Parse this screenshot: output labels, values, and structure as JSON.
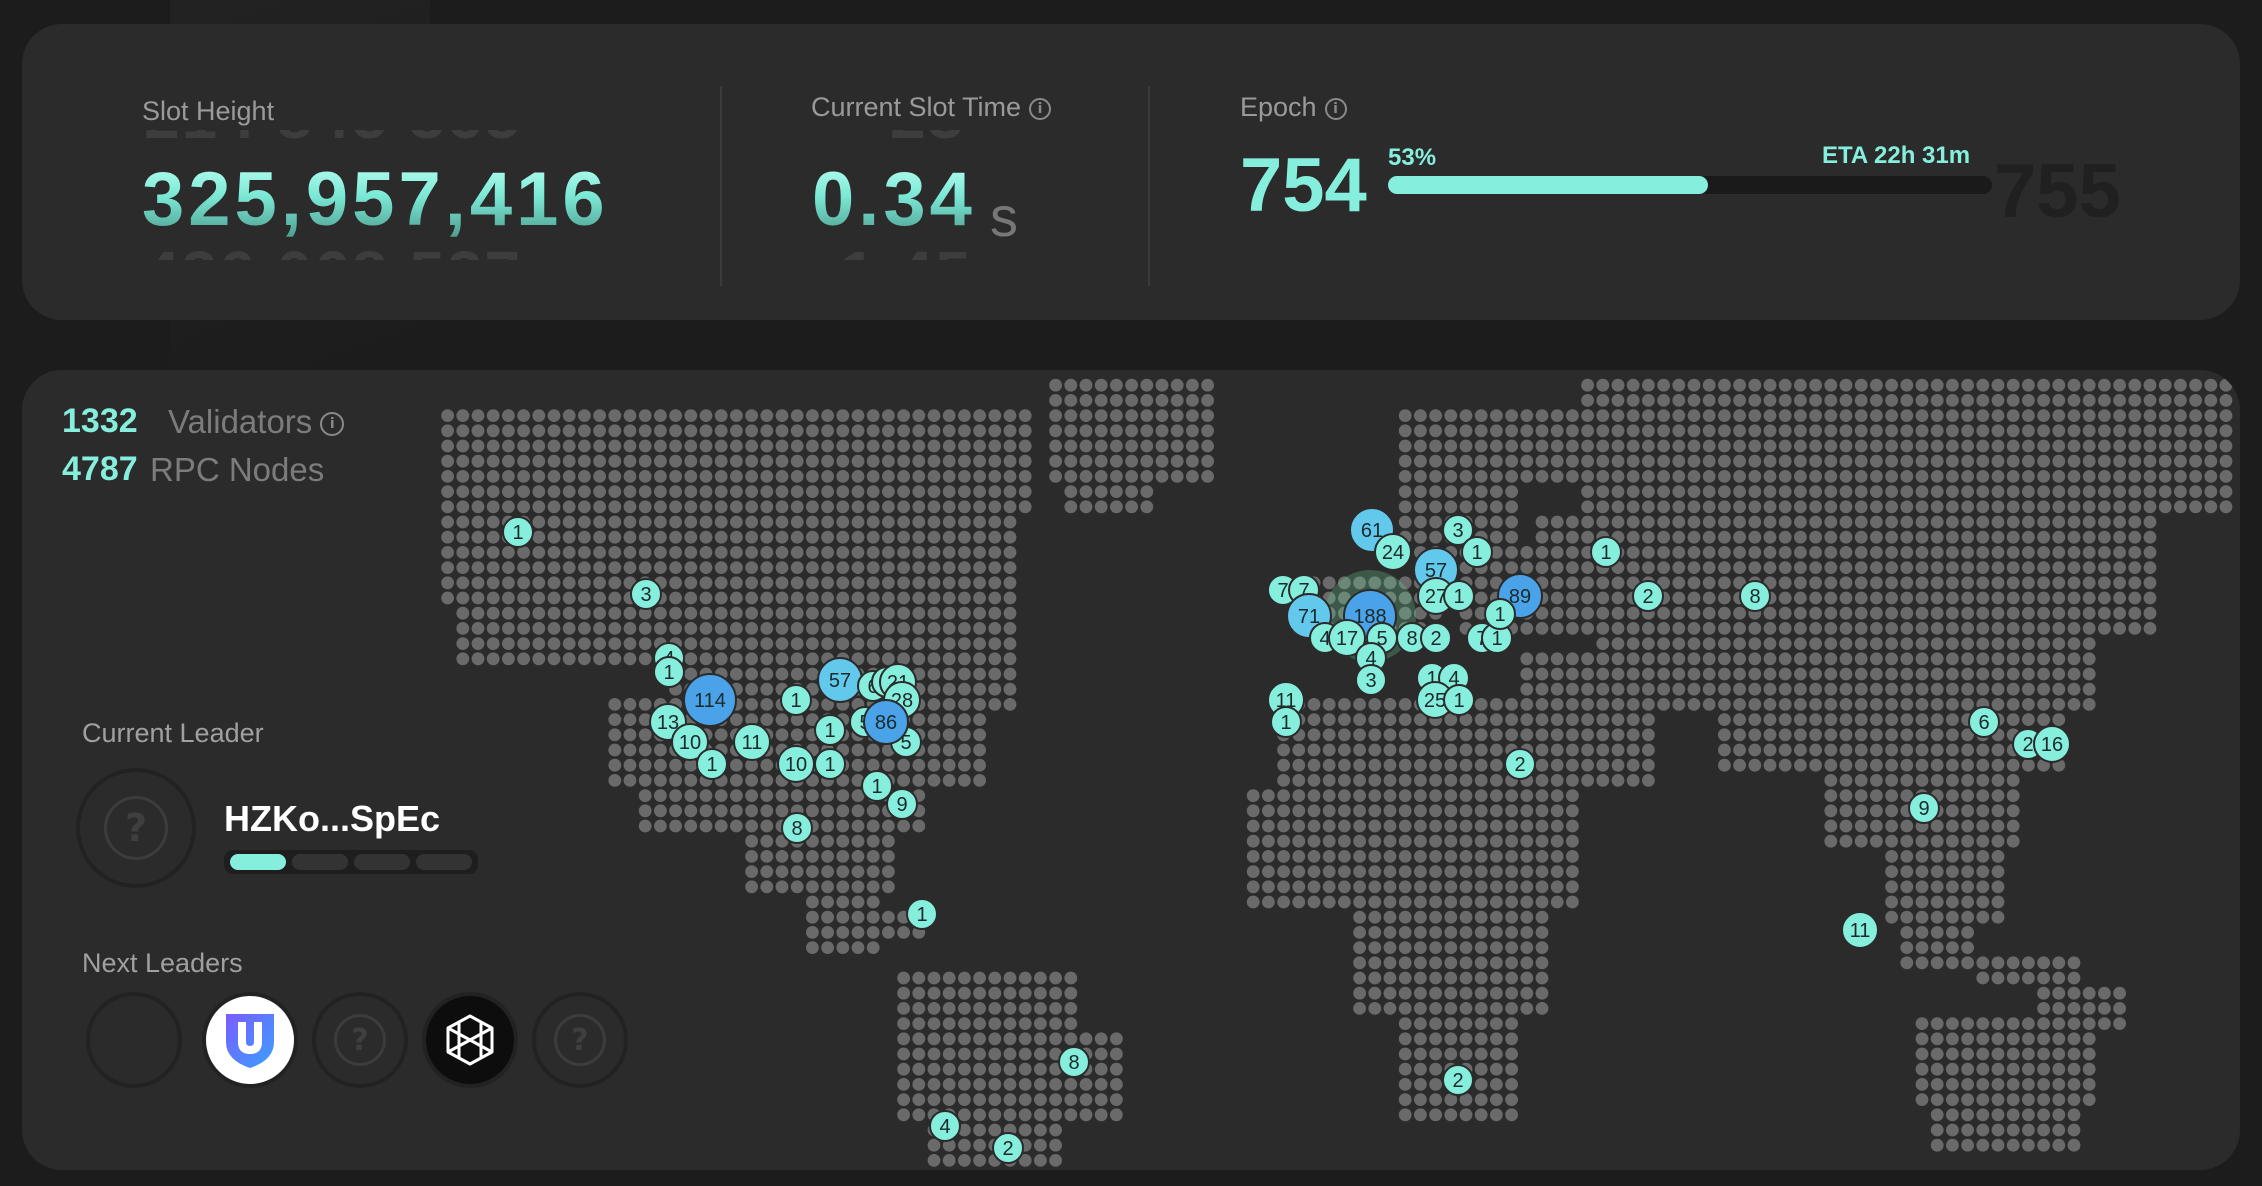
{
  "stats": {
    "slot_height": {
      "label": "Slot Height",
      "value": "325,957,416",
      "prev_ghost": "214 845 365",
      "next_ghost": "436 068 527"
    },
    "slot_time": {
      "label": "Current Slot Time",
      "value": "0.34",
      "unit": "s",
      "prev_ghost": "23",
      "next_ghost": "1.45"
    },
    "epoch": {
      "label": "Epoch",
      "current": "754",
      "next": "755",
      "progress_label": "53%",
      "progress_fraction": 0.53,
      "eta": "ETA 22h 31m"
    }
  },
  "network": {
    "validators_count": "1332",
    "validators_label": "Validators",
    "rpc_count": "4787",
    "rpc_label": "RPC Nodes"
  },
  "current_leader": {
    "section_label": "Current Leader",
    "name": "HZKo...SpEc",
    "slots_done": 1,
    "slots_total": 4
  },
  "next_leaders": {
    "section_label": "Next Leaders",
    "items": [
      {
        "kind": "blank",
        "icon": "empty-avatar-icon"
      },
      {
        "kind": "logo",
        "icon": "shield-u-logo-icon"
      },
      {
        "kind": "unknown",
        "icon": "question-mark-icon"
      },
      {
        "kind": "logo",
        "icon": "hexagon-cube-logo-icon"
      },
      {
        "kind": "unknown",
        "icon": "question-mark-icon"
      }
    ]
  },
  "map_markers": [
    {
      "label": "1"
    },
    {
      "label": "3"
    },
    {
      "label": "4"
    },
    {
      "label": "1"
    },
    {
      "label": "114"
    },
    {
      "label": "13"
    },
    {
      "label": "10"
    },
    {
      "label": "1"
    },
    {
      "label": "11"
    },
    {
      "label": "10"
    },
    {
      "label": "1"
    },
    {
      "label": "1"
    },
    {
      "label": "57"
    },
    {
      "label": "1"
    },
    {
      "label": "6"
    },
    {
      "label": "5"
    },
    {
      "label": "6"
    },
    {
      "label": "21"
    },
    {
      "label": "5"
    },
    {
      "label": "28"
    },
    {
      "label": "86"
    },
    {
      "label": "1"
    },
    {
      "label": "9"
    },
    {
      "label": "8"
    },
    {
      "label": "1"
    },
    {
      "label": "8"
    },
    {
      "label": "4"
    },
    {
      "label": "2"
    },
    {
      "label": "61"
    },
    {
      "label": "24"
    },
    {
      "label": "3"
    },
    {
      "label": "1"
    },
    {
      "label": "57"
    },
    {
      "label": "7"
    },
    {
      "label": "7"
    },
    {
      "label": "71"
    },
    {
      "label": "188"
    },
    {
      "label": "4"
    },
    {
      "label": "17"
    },
    {
      "label": "5"
    },
    {
      "label": "8"
    },
    {
      "label": "2"
    },
    {
      "label": "27"
    },
    {
      "label": "1"
    },
    {
      "label": "89"
    },
    {
      "label": "7"
    },
    {
      "label": "1"
    },
    {
      "label": "1"
    },
    {
      "label": "4"
    },
    {
      "label": "3"
    },
    {
      "label": "1"
    },
    {
      "label": "4"
    },
    {
      "label": "25"
    },
    {
      "label": "1"
    },
    {
      "label": "11"
    },
    {
      "label": "1"
    },
    {
      "label": "2"
    },
    {
      "label": "1"
    },
    {
      "label": "2"
    },
    {
      "label": "8"
    },
    {
      "label": "6"
    },
    {
      "label": "2"
    },
    {
      "label": "16"
    },
    {
      "label": "9"
    },
    {
      "label": "11"
    },
    {
      "label": "2"
    }
  ],
  "colors": {
    "accent": "#86eedc",
    "marker_light": "#86eedc",
    "marker_medium": "#62c8ec",
    "marker_large": "#4aa3e8",
    "map_dot": "#6a6a6a",
    "card_bg": "#2b2b2b",
    "page_bg": "#1c1c1c"
  }
}
